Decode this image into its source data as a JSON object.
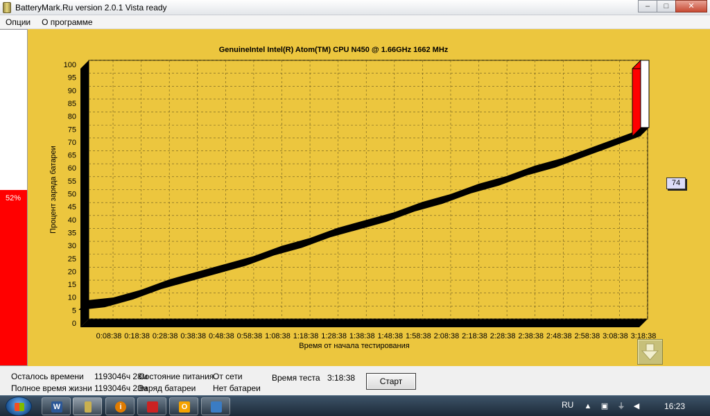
{
  "window": {
    "title": "BatteryMark.Ru version 2.0.1 Vista ready",
    "buttons": {
      "minimize": "–",
      "maximize": "□",
      "close": "✕"
    }
  },
  "menu": {
    "items": [
      "Опции",
      "О программе"
    ]
  },
  "battery_indicator": {
    "percent_label": "52%",
    "level": 0.52,
    "fill_color": "#ff0000"
  },
  "chart_data": {
    "type": "line",
    "title": "GenuineIntel Intel(R) Atom(TM) CPU N450   @ 1.66GHz 1662 MHz",
    "xlabel": "Время от начала тестирования",
    "ylabel": "Процент заряда батареи",
    "ylim": [
      0,
      100
    ],
    "y_ticks": [
      0,
      5,
      10,
      15,
      20,
      25,
      30,
      35,
      40,
      45,
      50,
      55,
      60,
      65,
      70,
      75,
      80,
      85,
      90,
      95,
      100
    ],
    "x_ticks": [
      "0:08:38",
      "0:18:38",
      "0:28:38",
      "0:38:38",
      "0:48:38",
      "0:58:38",
      "1:08:38",
      "1:18:38",
      "1:28:38",
      "1:38:38",
      "1:48:38",
      "1:58:38",
      "2:08:38",
      "2:18:38",
      "2:28:38",
      "2:38:38",
      "2:48:38",
      "2:58:38",
      "3:08:38",
      "3:18:38"
    ],
    "grid": true,
    "background": "#ecc63e",
    "series": [
      {
        "color": "#000000",
        "x": [
          "0:00:00",
          "0:08:38",
          "0:18:38",
          "0:28:38",
          "0:38:38",
          "0:48:38",
          "0:58:38",
          "1:08:38",
          "1:18:38",
          "1:28:38",
          "1:38:38",
          "1:48:38",
          "1:58:38",
          "2:08:38",
          "2:18:38",
          "2:28:38",
          "2:38:38",
          "2:48:38",
          "2:58:38",
          "3:08:38",
          "3:18:38"
        ],
        "y": [
          7,
          8,
          11,
          15,
          18,
          21,
          24,
          28,
          31,
          35,
          38,
          41,
          45,
          48,
          52,
          55,
          59,
          62,
          66,
          70,
          74
        ]
      }
    ],
    "current_value": 74,
    "current_value_color": "#ff0000"
  },
  "value_badge": "74",
  "status": {
    "time_left_label": "Осталось времени",
    "time_left_value": "1193046ч 28м",
    "full_life_label": "Полное время жизни",
    "full_life_value": "1193046ч 28м",
    "power_state_label": "Состояние питания",
    "power_state_value": "От сети",
    "battery_charge_label": "Заряд батареи",
    "battery_charge_value": "Нет батареи",
    "test_time_label": "Время теста",
    "test_time_value": "3:18:38",
    "start_button": "Старт"
  },
  "taskbar": {
    "apps": [
      {
        "name": "word",
        "glyph": "W",
        "color": "#2b5797"
      },
      {
        "name": "batterymark",
        "glyph": "",
        "color": "#c9b050"
      },
      {
        "name": "info-app",
        "glyph": "i",
        "color": "#e07b00"
      },
      {
        "name": "floppy-app",
        "glyph": "",
        "color": "#c22"
      },
      {
        "name": "outlook-app",
        "glyph": "O",
        "color": "#f5a300"
      },
      {
        "name": "network-app",
        "glyph": "",
        "color": "#3a7cc4"
      }
    ],
    "language": "RU",
    "clock": "16:23"
  }
}
